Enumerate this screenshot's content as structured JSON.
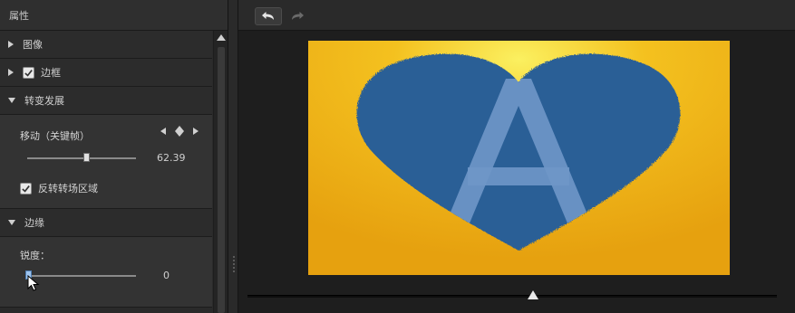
{
  "panel": {
    "title": "属性",
    "sections": {
      "image": {
        "label": "图像",
        "expanded": false
      },
      "border": {
        "label": "边框",
        "checked": true,
        "expanded": false
      },
      "transition": {
        "label": "转变发展",
        "expanded": true,
        "move_label": "移动（关键帧）",
        "move_value": "62.39",
        "move_fraction": 0.55,
        "reverse_label": "反转转场区域",
        "reverse_checked": true
      },
      "edge": {
        "label": "边缘",
        "expanded": true,
        "sharpness_label": "锐度：",
        "sharpness_value": "0",
        "sharpness_fraction": 0.0
      }
    }
  },
  "icons": {
    "collapsed": "triangle-right",
    "expanded": "triangle-down",
    "checkbox": "checkmark",
    "keyframe_prev": "triangle-left",
    "keyframe_add": "diamond",
    "keyframe_next": "triangle-right",
    "undo": "undo-arrow",
    "redo": "redo-arrow",
    "playhead": "triangle-up"
  },
  "preview": {
    "letter": "A",
    "timeline_fraction": 0.54,
    "colors": {
      "background": "#f2b21a",
      "heart": "#2c5f96",
      "letter": "#6f97c8"
    }
  }
}
